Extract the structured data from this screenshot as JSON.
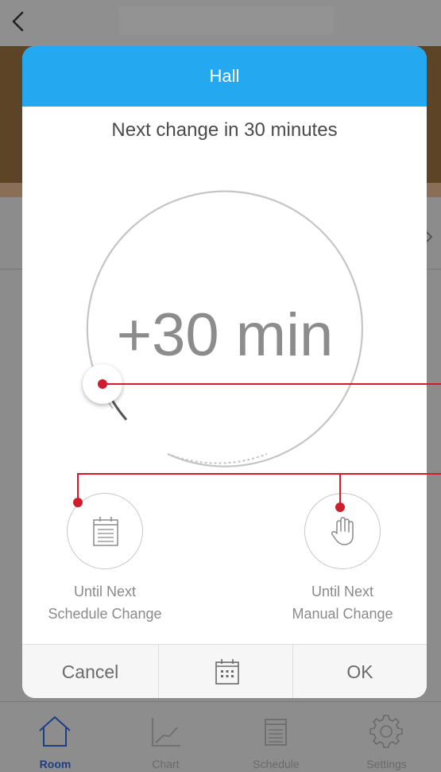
{
  "header": {
    "title": "Hall"
  },
  "status": {
    "next_change": "Next change in 30 minutes"
  },
  "dial": {
    "value_label": "+30 min",
    "progress_fraction": 0.12
  },
  "options": [
    {
      "line1": "Until Next",
      "line2": "Schedule Change",
      "icon": "calendar-icon"
    },
    {
      "line1": "Until Next",
      "line2": "Manual Change",
      "icon": "hand-icon"
    }
  ],
  "footer": {
    "cancel": "Cancel",
    "ok": "OK",
    "calendar_icon": "calendar-grid-icon"
  },
  "tabs": [
    {
      "label": "Room",
      "icon": "home-icon",
      "active": true
    },
    {
      "label": "Chart",
      "icon": "chart-icon",
      "active": false
    },
    {
      "label": "Schedule",
      "icon": "schedule-icon",
      "active": false
    },
    {
      "label": "Settings",
      "icon": "gear-icon",
      "active": false
    }
  ],
  "colors": {
    "accent": "#24a8f0",
    "annotation": "#d01c2c",
    "active_tab": "#1d3f86"
  }
}
